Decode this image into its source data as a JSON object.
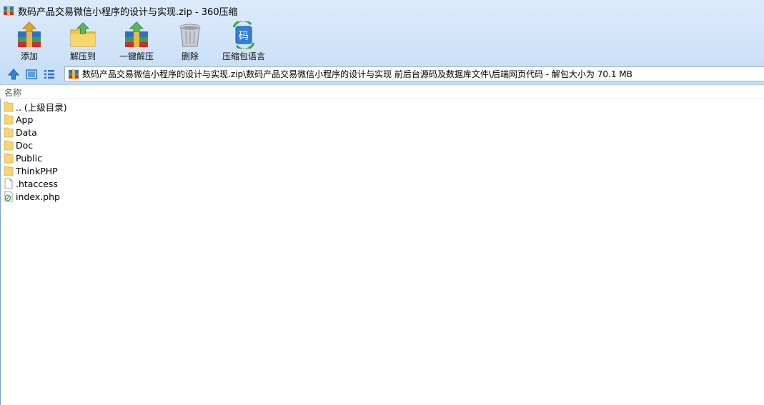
{
  "window": {
    "title": "数码产品交易微信小程序的设计与实现.zip - 360压缩"
  },
  "toolbar": {
    "add": "添加",
    "extract_to": "解压到",
    "one_click_extract": "一键解压",
    "delete": "删除",
    "archive_language": "压缩包语言",
    "language_icon_text": "码"
  },
  "address": {
    "path": "数码产品交易微信小程序的设计与实现.zip\\数码产品交易微信小程序的设计与实现 前后台源码及数据库文件\\后端网页代码 - 解包大小为 70.1 MB"
  },
  "columns": {
    "name": "名称"
  },
  "files": [
    {
      "name": ".. (上级目录)",
      "type": "folder"
    },
    {
      "name": "App",
      "type": "folder"
    },
    {
      "name": "Data",
      "type": "folder"
    },
    {
      "name": "Doc",
      "type": "folder"
    },
    {
      "name": "Public",
      "type": "folder"
    },
    {
      "name": "ThinkPHP",
      "type": "folder"
    },
    {
      "name": ".htaccess",
      "type": "file"
    },
    {
      "name": "index.php",
      "type": "php"
    }
  ]
}
